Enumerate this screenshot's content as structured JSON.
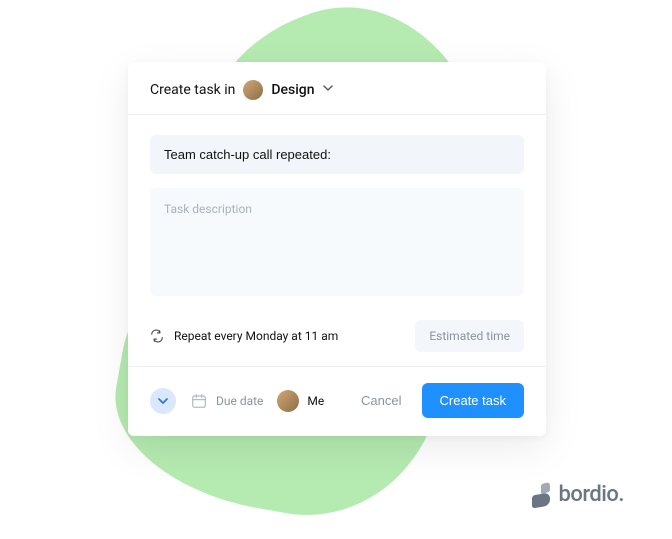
{
  "header": {
    "prefix": "Create task in",
    "project": "Design"
  },
  "task": {
    "title": "Team catch-up call repeated:",
    "description": "",
    "description_placeholder": "Task description",
    "repeat_text": "Repeat every Monday at 11 am",
    "estimated_label": "Estimated time"
  },
  "footer": {
    "due_date_label": "Due date",
    "assignee": "Me",
    "cancel_label": "Cancel",
    "create_label": "Create task"
  },
  "brand": {
    "name": "bordio."
  }
}
